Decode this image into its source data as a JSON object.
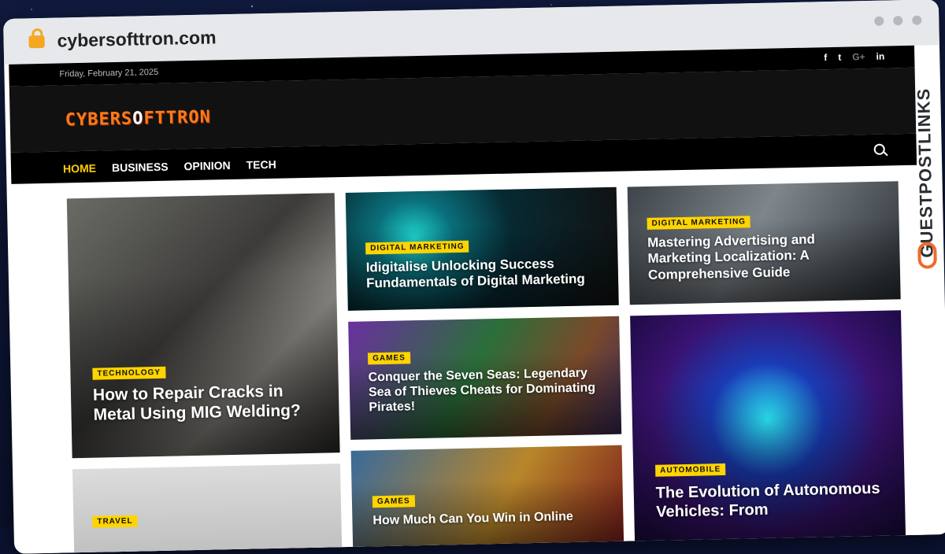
{
  "browser": {
    "url": "cybersofttron.com"
  },
  "topbar": {
    "date": "Friday, February 21, 2025",
    "social": [
      "f",
      "t",
      "G+",
      "in"
    ]
  },
  "site": {
    "logo_text_a": "CYBERS",
    "logo_text_o": "O",
    "logo_text_b": "FTTRON"
  },
  "nav": {
    "items": [
      "HOME",
      "BUSINESS",
      "OPINION",
      "TECH"
    ]
  },
  "watermark": {
    "text": "GUESTPOSTLINKS"
  },
  "posts": [
    {
      "category": "TECHNOLOGY",
      "title": "How to Repair Cracks in Metal Using MIG Welding?"
    },
    {
      "category": "DIGITAL MARKETING",
      "title": "Idigitalise Unlocking Success Fundamentals of Digital Marketing"
    },
    {
      "category": "DIGITAL MARKETING",
      "title": "Mastering Advertising and Marketing Localization: A Comprehensive Guide"
    },
    {
      "category": "GAMES",
      "title": "Conquer the Seven Seas: Legendary Sea of Thieves Cheats for Dominating Pirates!"
    },
    {
      "category": "AUTOMOBILE",
      "title": "The Evolution of Autonomous Vehicles: From"
    },
    {
      "category": "TRAVEL",
      "title": ""
    },
    {
      "category": "GAMES",
      "title": "How Much Can You Win in Online"
    }
  ]
}
